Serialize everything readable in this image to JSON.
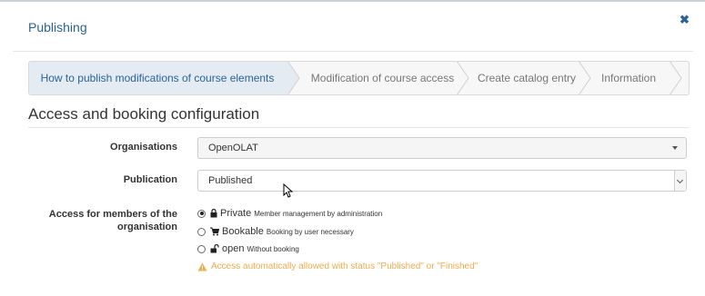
{
  "modal": {
    "title": "Publishing",
    "close_icon": "times-icon"
  },
  "wizard": {
    "steps": [
      {
        "label": "How to publish modifications of course elements",
        "active": true
      },
      {
        "label": "Modification of course access",
        "active": false
      },
      {
        "label": "Create catalog entry",
        "active": false
      },
      {
        "label": "Information",
        "active": false
      }
    ]
  },
  "section": {
    "title": "Access and booking configuration"
  },
  "form": {
    "organisations": {
      "label": "Organisations",
      "value": "OpenOLAT"
    },
    "publication": {
      "label": "Publication",
      "value": "Published"
    },
    "access": {
      "label_line1": "Access for members of the",
      "label_line2": "organisation",
      "options": [
        {
          "icon": "lock-icon",
          "main": "Private",
          "sub": "Member management by administration",
          "checked": true
        },
        {
          "icon": "cart-icon",
          "main": "Bookable",
          "sub": "Booking by user necessary",
          "checked": false
        },
        {
          "icon": "unlock-icon",
          "main": "open",
          "sub": "Without booking",
          "checked": false
        }
      ],
      "warning": "Access automatically allowed with status \"Published\" or \"Finished\""
    }
  },
  "colors": {
    "link": "#2a6496",
    "warning": "#f0ad4e",
    "active_step": "#e4ebf2"
  }
}
